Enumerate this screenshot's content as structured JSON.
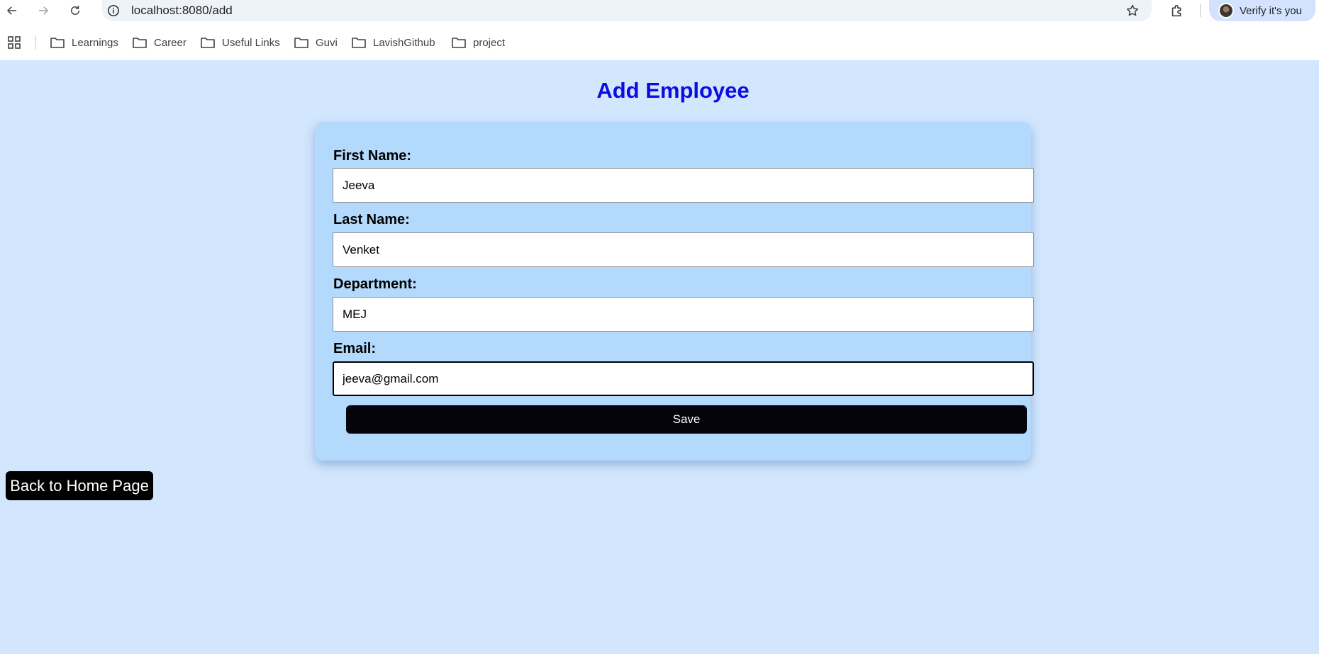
{
  "browser": {
    "url": "localhost:8080/add",
    "profile_label": "Verify it's you"
  },
  "bookmarks": [
    {
      "label": "Learnings"
    },
    {
      "label": "Career"
    },
    {
      "label": "Useful Links"
    },
    {
      "label": "Guvi"
    },
    {
      "label": "LavishGithub"
    },
    {
      "label": "project"
    }
  ],
  "page": {
    "title": "Add Employee",
    "back_button": "Back to Home Page"
  },
  "form": {
    "first_name": {
      "label": "First Name:",
      "value": "Jeeva"
    },
    "last_name": {
      "label": "Last Name:",
      "value": "Venket"
    },
    "department": {
      "label": "Department:",
      "value": "MEJ"
    },
    "email": {
      "label": "Email:",
      "value": "jeeva@gmail.com"
    },
    "save_label": "Save"
  },
  "colors": {
    "page_background": "#d2e6fd",
    "card_background": "#b3dafc",
    "title": "#0b0be4",
    "button": "#000000"
  },
  "icons": [
    "back-arrow-icon",
    "forward-arrow-icon",
    "reload-icon",
    "info-icon",
    "star-icon",
    "extensions-icon",
    "apps-grid-icon",
    "folder-icon"
  ]
}
